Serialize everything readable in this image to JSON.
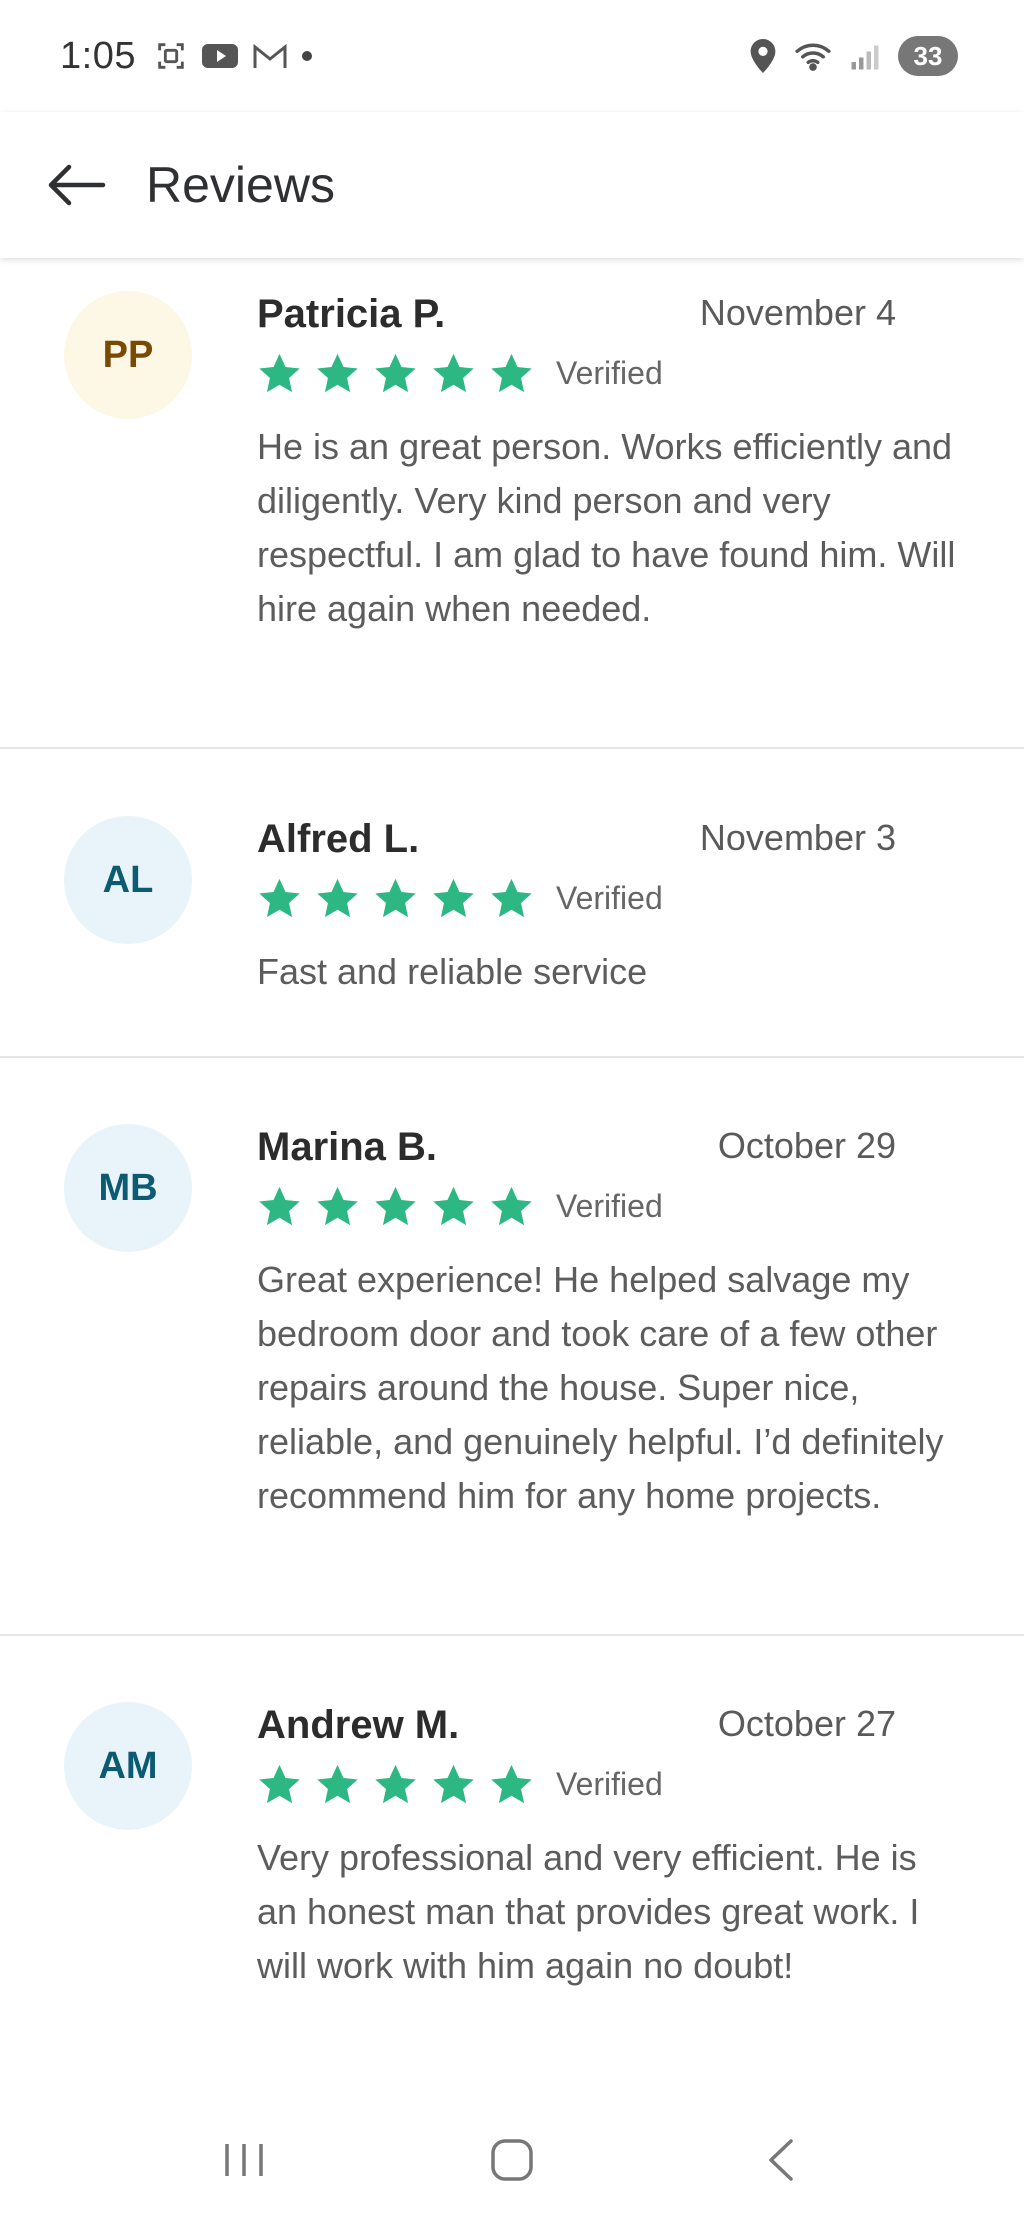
{
  "status_bar": {
    "time": "1:05",
    "battery": "33",
    "icons": [
      "screenshot-icon",
      "youtube-icon",
      "gmail-icon",
      "location-icon",
      "wifi-icon",
      "signal-icon"
    ]
  },
  "app_bar": {
    "title": "Reviews"
  },
  "reviews": [
    {
      "initials": "PP",
      "name": "Patricia P.",
      "date": "November 4",
      "rating": 5,
      "verified": "Verified",
      "text": "He is an great person. Works efficiently and diligently. Very kind person and very respectful. I am glad to have found him. Will hire again when needed.",
      "avatar_bg": "#fdf7e6",
      "avatar_fg": "#7a4a00"
    },
    {
      "initials": "AL",
      "name": "Alfred L.",
      "date": "November 3",
      "rating": 5,
      "verified": "Verified",
      "text": "Fast and reliable service",
      "avatar_bg": "#e8f4f9",
      "avatar_fg": "#0d5a73"
    },
    {
      "initials": "MB",
      "name": "Marina B.",
      "date": "October 29",
      "rating": 5,
      "verified": "Verified",
      "text": "Great experience! He helped salvage my bedroom door and took care of a few other repairs around the house. Super nice, reliable, and genuinely helpful. I’d definitely recommend him for any home projects.",
      "avatar_bg": "#e8f4f9",
      "avatar_fg": "#0d5a73"
    },
    {
      "initials": "AM",
      "name": "Andrew M.",
      "date": "October 27",
      "rating": 5,
      "verified": "Verified",
      "text": "Very professional and very efficient. He is an honest man that provides great work. I will work with him again no doubt!",
      "avatar_bg": "#e8f4f9",
      "avatar_fg": "#0d5a73"
    }
  ],
  "colors": {
    "star": "#2db783",
    "divider": "#e6e6e6"
  }
}
